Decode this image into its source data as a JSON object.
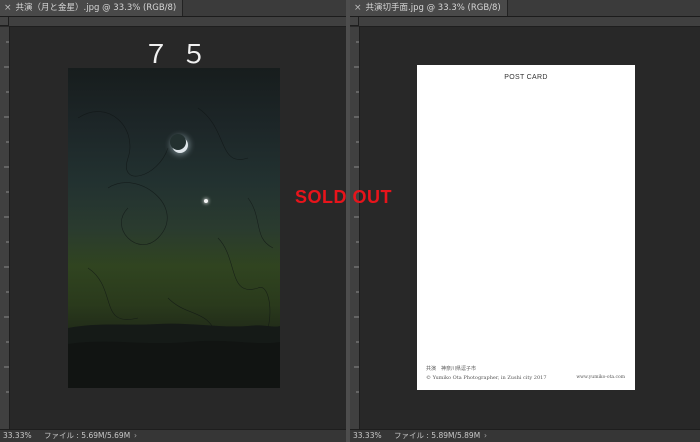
{
  "left_window": {
    "tab_title": "共演（月と金星）.jpg @ 33.3% (RGB/8)",
    "close_glyph": "×",
    "counter": "７５",
    "zoom": "33.33%",
    "file_info": "ファイル : 5.69M/5.69M",
    "status_arrow": "›"
  },
  "right_window": {
    "tab_title": "共演切手面.jpg @ 33.3% (RGB/8)",
    "close_glyph": "×",
    "postcard_title": "POST CARD",
    "credit_line1": "共演　神奈川県逗子市",
    "credit_line2": "© Yumiko Ota Photographer, in Zushi city 2017",
    "website": "www.yumiko-ota.com",
    "zoom": "33.33%",
    "file_info": "ファイル : 5.89M/5.89M",
    "status_arrow": "›"
  },
  "overlay": {
    "sold_out": "SOLD OUT"
  },
  "colors": {
    "sold_out": "#e8141b",
    "workspace": "#2a2a2a"
  }
}
